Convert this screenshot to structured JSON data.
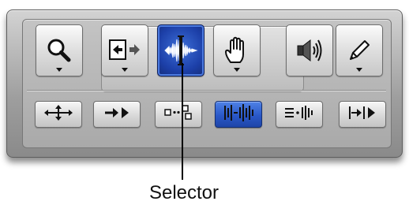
{
  "toolbar": {
    "tools": [
      {
        "id": "zoomer",
        "icon": "magnifier-icon",
        "has_menu": true,
        "selected": false
      },
      {
        "id": "trim",
        "icon": "trim-bracket-icon",
        "has_menu": true,
        "selected": false
      },
      {
        "id": "selector",
        "icon": "waveform-selector-icon",
        "has_menu": false,
        "selected": true
      },
      {
        "id": "grabber",
        "icon": "hand-icon",
        "has_menu": true,
        "selected": false
      },
      {
        "id": "scrubber",
        "icon": "speaker-icon",
        "has_menu": false,
        "selected": false
      },
      {
        "id": "pencil",
        "icon": "pencil-icon",
        "has_menu": true,
        "selected": false
      }
    ],
    "modes": [
      {
        "id": "zoom-toggle",
        "icon": "expand-arrows-icon",
        "active": false
      },
      {
        "id": "tab-to-transient",
        "icon": "arrow-to-play-icon",
        "active": false
      },
      {
        "id": "link-timeline-edit",
        "icon": "link-squares-icon",
        "active": false
      },
      {
        "id": "link-track-edit",
        "icon": "linked-waveform-icon",
        "active": true
      },
      {
        "id": "mirror-midi",
        "icon": "lines-to-bars-icon",
        "active": false
      },
      {
        "id": "insertion-follows",
        "icon": "bracket-play-icon",
        "active": false
      }
    ],
    "selected_color": "#2a58c8"
  },
  "callout": {
    "label": "Selector"
  }
}
